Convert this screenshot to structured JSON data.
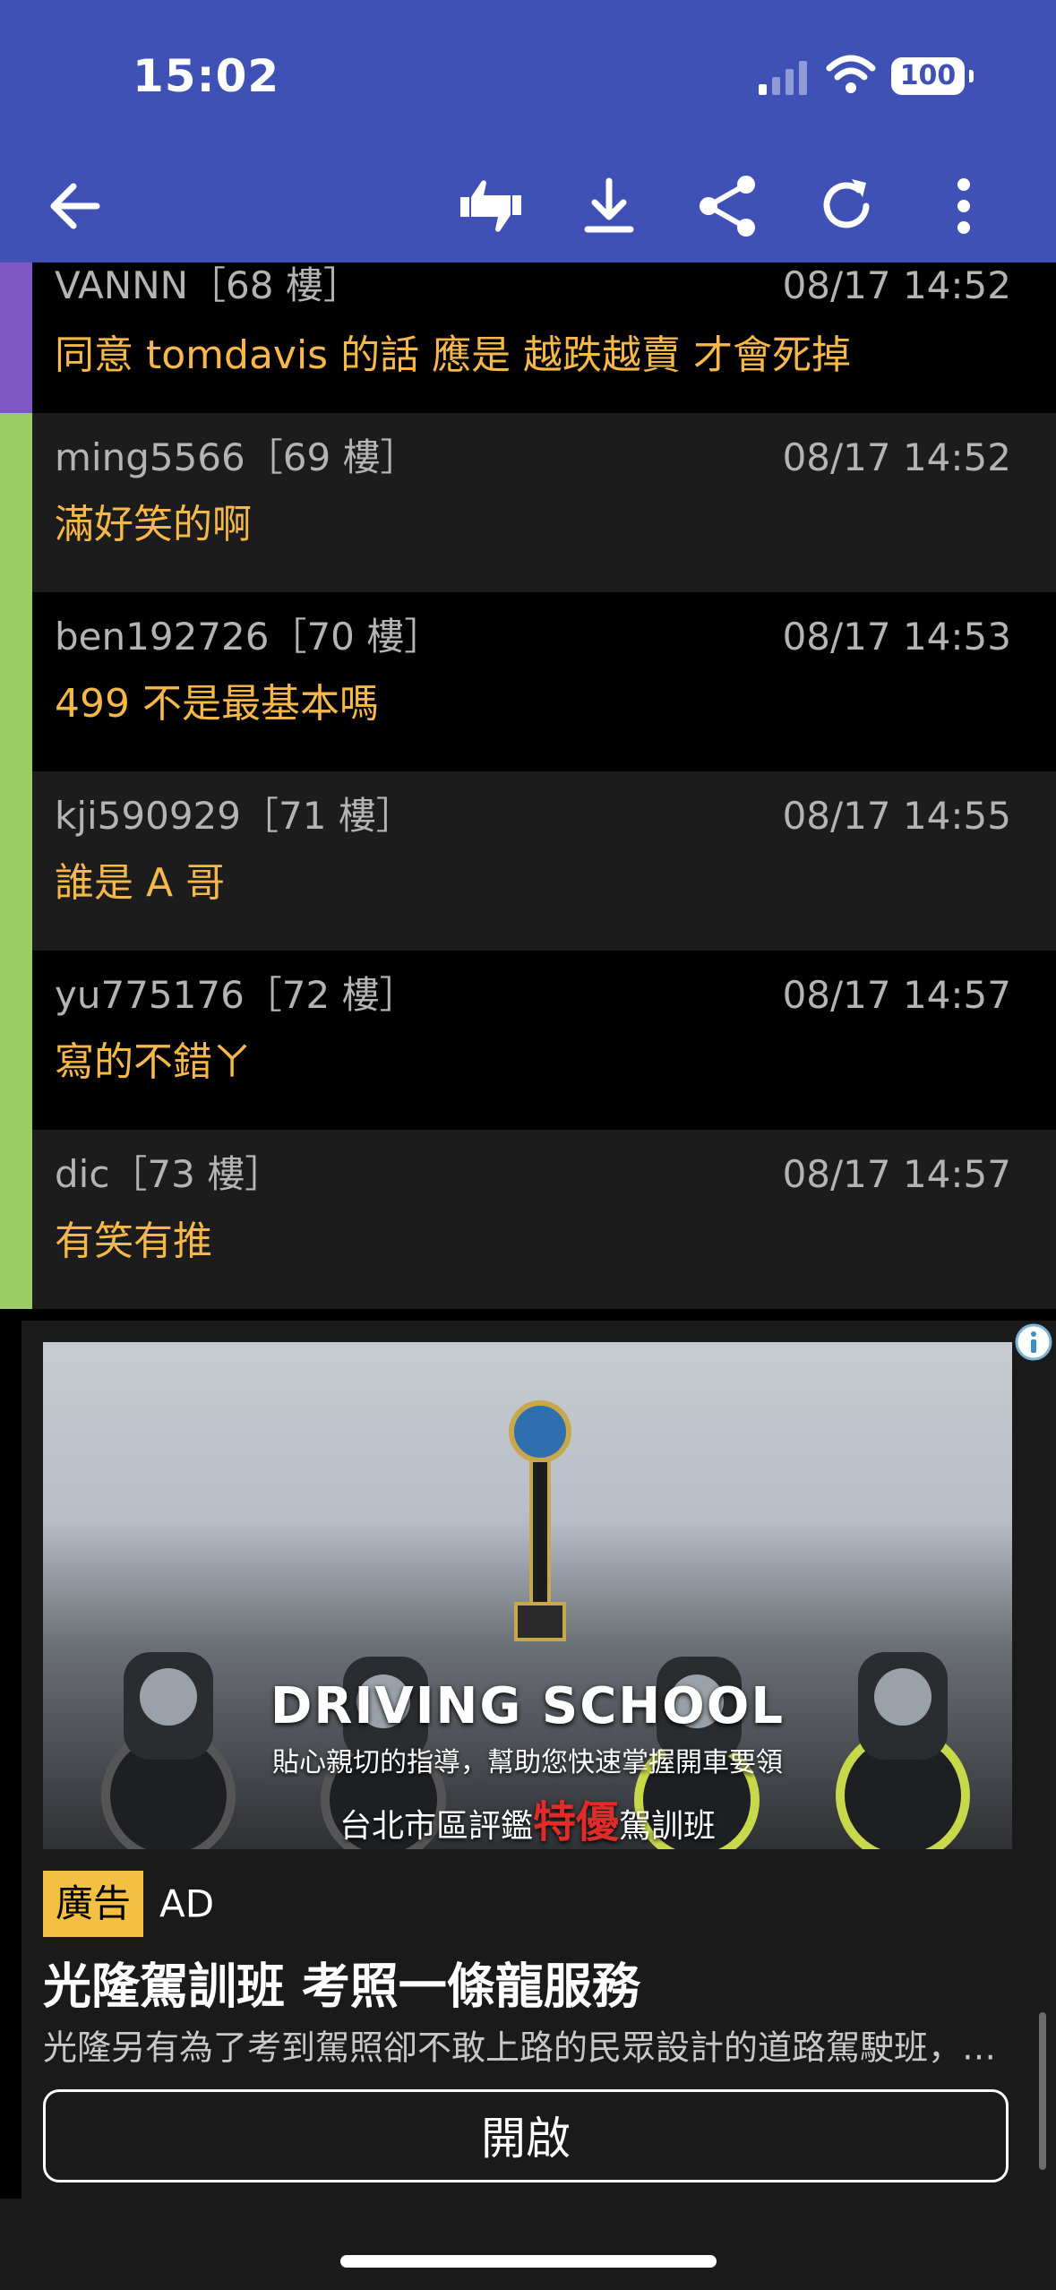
{
  "status_bar": {
    "time": "15:02",
    "battery": "100",
    "signal_icon": "signal-icon",
    "wifi_icon": "wifi-icon"
  },
  "toolbar": {
    "back_icon": "back-arrow-icon",
    "icons": [
      "thumbs-up-down-icon",
      "download-icon",
      "share-icon",
      "refresh-icon",
      "more-vert-icon"
    ],
    "bg_color": "#3f51b5"
  },
  "comments": [
    {
      "author": "VANNN［68 樓］",
      "time": "08/17 14:52",
      "text": "同意 tomdavis 的話  應是 越跌越賣 才會死掉",
      "stripe": "#7e57c2",
      "bg": "#000000"
    },
    {
      "author": "ming5566［69 樓］",
      "time": "08/17 14:52",
      "text": "滿好笑的啊",
      "stripe": "#9ccc65",
      "bg": "#1c1c1c"
    },
    {
      "author": "ben192726［70 樓］",
      "time": "08/17 14:53",
      "text": "499 不是最基本嗎",
      "stripe": "#9ccc65",
      "bg": "#000000"
    },
    {
      "author": "kji590929［71 樓］",
      "time": "08/17 14:55",
      "text": "誰是 A 哥",
      "stripe": "#9ccc65",
      "bg": "#1c1c1c"
    },
    {
      "author": "yu775176［72 樓］",
      "time": "08/17 14:57",
      "text": "寫的不錯ㄚ",
      "stripe": "#9ccc65",
      "bg": "#000000"
    },
    {
      "author": "dic［73 樓］",
      "time": "08/17 14:57",
      "text": "有笑有推",
      "stripe": "#9ccc65",
      "bg": "#1c1c1c"
    }
  ],
  "ad": {
    "image_headline": "DRIVING SCHOOL",
    "image_subline": "貼心親切的指導，幫助您快速掌握開車要領",
    "image_subline2_prefix": "台北市區評鑑",
    "image_subline2_highlight": "特優",
    "image_subline2_suffix": "駕訓班",
    "badge": "廣告",
    "label": "AD",
    "title": "光隆駕訓班 考照一條龍服務",
    "description": "光隆另有為了考到駕照卻不敢上路的民眾設計的道路駕駛班，讓您安心上路",
    "button": "開啟",
    "info_icon": "info-icon"
  },
  "colors": {
    "author_text": "#b4b4b4",
    "message_text": "#f7b84a",
    "badge_bg": "#f4c043"
  }
}
